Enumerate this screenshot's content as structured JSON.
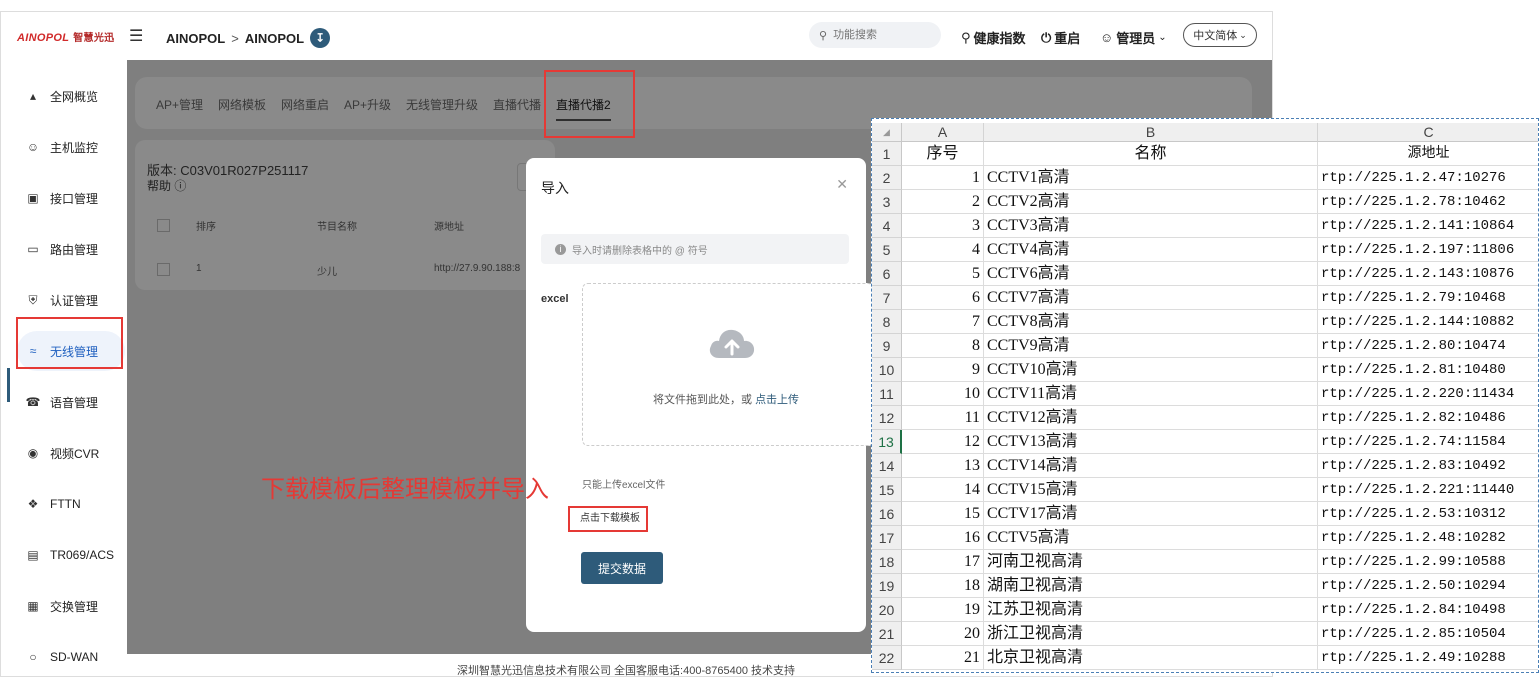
{
  "header": {
    "logo_text": "AINOPOL",
    "logo_cn": "智慧光迅",
    "menu_icon": "menu-icon",
    "breadcrumb": [
      "AINOPOL",
      "AINOPOL"
    ],
    "breadcrumb_separator": ">",
    "breadcrumb_badge_icon": "download-icon",
    "search_placeholder": "功能搜索",
    "health": "健康指数",
    "restart": "重启",
    "admin": "管理员",
    "language": "中文简体"
  },
  "sidebar": {
    "items": [
      {
        "label": "全网概览",
        "icon": "network-icon"
      },
      {
        "label": "主机监控",
        "icon": "user-icon"
      },
      {
        "label": "接口管理",
        "icon": "port-icon"
      },
      {
        "label": "路由管理",
        "icon": "monitor-icon"
      },
      {
        "label": "认证管理",
        "icon": "shield-icon"
      },
      {
        "label": "无线管理",
        "icon": "wifi-icon"
      },
      {
        "label": "语音管理",
        "icon": "sip-icon"
      },
      {
        "label": "视频CVR",
        "icon": "camera-icon"
      },
      {
        "label": "FTTN",
        "icon": "fttn-icon"
      },
      {
        "label": "TR069/ACS",
        "icon": "router-icon"
      },
      {
        "label": "交换管理",
        "icon": "switch-icon"
      },
      {
        "label": "SD-WAN",
        "icon": "sdwan-icon"
      }
    ],
    "active_index": 5
  },
  "tabs": [
    "AP+管理",
    "网络模板",
    "网络重启",
    "AP+升级",
    "无线管理升级",
    "直播代播",
    "直播代播2"
  ],
  "active_tab": 6,
  "version_label": "版本:  C03V01R027P251117",
  "help_label": "帮助",
  "table": {
    "headers": [
      "排序",
      "节目名称",
      "源地址"
    ],
    "rows": [
      [
        "1",
        "少儿",
        "http://27.9.90.188:8"
      ]
    ]
  },
  "footer": "深圳智慧光迅信息技术有限公司   全国客服电话:400-8765400   技术支持",
  "modal": {
    "title": "导入",
    "alert": "导入时请删除表格中的 @ 符号",
    "field_label": "excel",
    "drop_text": "将文件拖到此处，或 ",
    "drop_link": "点击上传",
    "tip": "只能上传excel文件",
    "download_link": "点击下载模板",
    "submit": "提交数据"
  },
  "annotation": "下载模板后整理模板并导入",
  "spreadsheet": {
    "columns": [
      "A",
      "B",
      "C"
    ],
    "header": [
      "序号",
      "名称",
      "源地址"
    ],
    "rows": [
      [
        "1",
        "CCTV1高清",
        "rtp://225.1.2.47:10276"
      ],
      [
        "2",
        "CCTV2高清",
        "rtp://225.1.2.78:10462"
      ],
      [
        "3",
        "CCTV3高清",
        "rtp://225.1.2.141:10864"
      ],
      [
        "4",
        "CCTV4高清",
        "rtp://225.1.2.197:11806"
      ],
      [
        "5",
        "CCTV6高清",
        "rtp://225.1.2.143:10876"
      ],
      [
        "6",
        "CCTV7高清",
        "rtp://225.1.2.79:10468"
      ],
      [
        "7",
        "CCTV8高清",
        "rtp://225.1.2.144:10882"
      ],
      [
        "8",
        "CCTV9高清",
        "rtp://225.1.2.80:10474"
      ],
      [
        "9",
        "CCTV10高清",
        "rtp://225.1.2.81:10480"
      ],
      [
        "10",
        "CCTV11高清",
        "rtp://225.1.2.220:11434"
      ],
      [
        "11",
        "CCTV12高清",
        "rtp://225.1.2.82:10486"
      ],
      [
        "12",
        "CCTV13高清",
        "rtp://225.1.2.74:11584"
      ],
      [
        "13",
        "CCTV14高清",
        "rtp://225.1.2.83:10492"
      ],
      [
        "14",
        "CCTV15高清",
        "rtp://225.1.2.221:11440"
      ],
      [
        "15",
        "CCTV17高清",
        "rtp://225.1.2.53:10312"
      ],
      [
        "16",
        "CCTV5高清",
        "rtp://225.1.2.48:10282"
      ],
      [
        "17",
        "河南卫视高清",
        "rtp://225.1.2.99:10588"
      ],
      [
        "18",
        "湖南卫视高清",
        "rtp://225.1.2.50:10294"
      ],
      [
        "19",
        "江苏卫视高清",
        "rtp://225.1.2.84:10498"
      ],
      [
        "20",
        "浙江卫视高清",
        "rtp://225.1.2.85:10504"
      ],
      [
        "21",
        "北京卫视高清",
        "rtp://225.1.2.49:10288"
      ]
    ],
    "row_numbers": [
      "1",
      "2",
      "3",
      "4",
      "5",
      "6",
      "7",
      "8",
      "9",
      "10",
      "11",
      "12",
      "13",
      "14",
      "15",
      "16",
      "17",
      "18",
      "19",
      "20",
      "21",
      "22"
    ],
    "selected_row": 13
  },
  "colors": {
    "primary": "#2e5b7a",
    "annotation": "#e53935",
    "overlay": "#7f7f7f"
  }
}
